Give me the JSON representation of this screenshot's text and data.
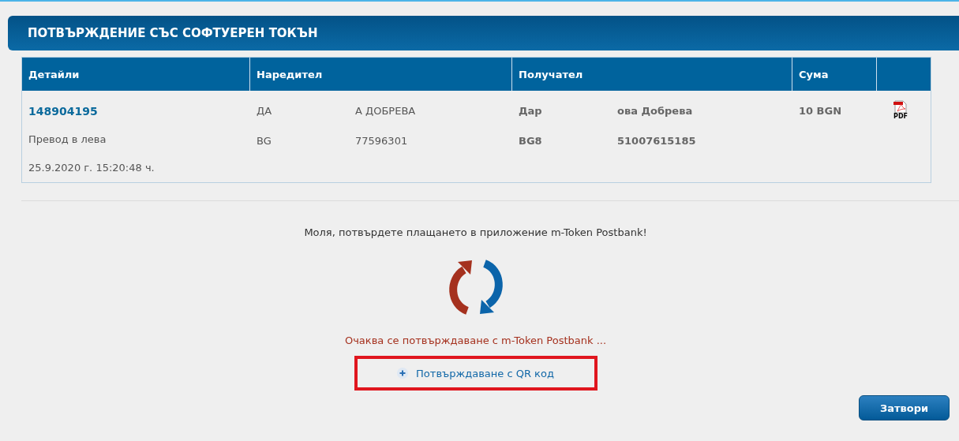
{
  "panel": {
    "title": "ПОТВЪРЖДЕНИЕ СЪС СОФТУЕРЕН ТОКЪН"
  },
  "table": {
    "columns": [
      "Детайли",
      "Наредител",
      "Получател",
      "Сума"
    ],
    "row": {
      "order_id": "148904195",
      "type": "Превод в лева",
      "datetime": "25.9.2020 г. 15:20:48 ч.",
      "sender_name": [
        "ДА",
        "А ДОБРЕВА"
      ],
      "sender_iban": [
        "BG",
        "77596301"
      ],
      "recipient_name": [
        "Дар",
        "ова Добрева"
      ],
      "recipient_iban": [
        "BG8",
        "51007615185"
      ],
      "amount": "10 BGN",
      "pdf_label": "PDF"
    }
  },
  "prompt": "Моля, потвърдете плащането в приложение m-Token Postbank!",
  "status": "Очаква се потвърждаване с m-Token Postbank ...",
  "qr_link": {
    "label": "Потвърждаване с QR код",
    "highlighted": true
  },
  "close_button": "Затвори"
}
